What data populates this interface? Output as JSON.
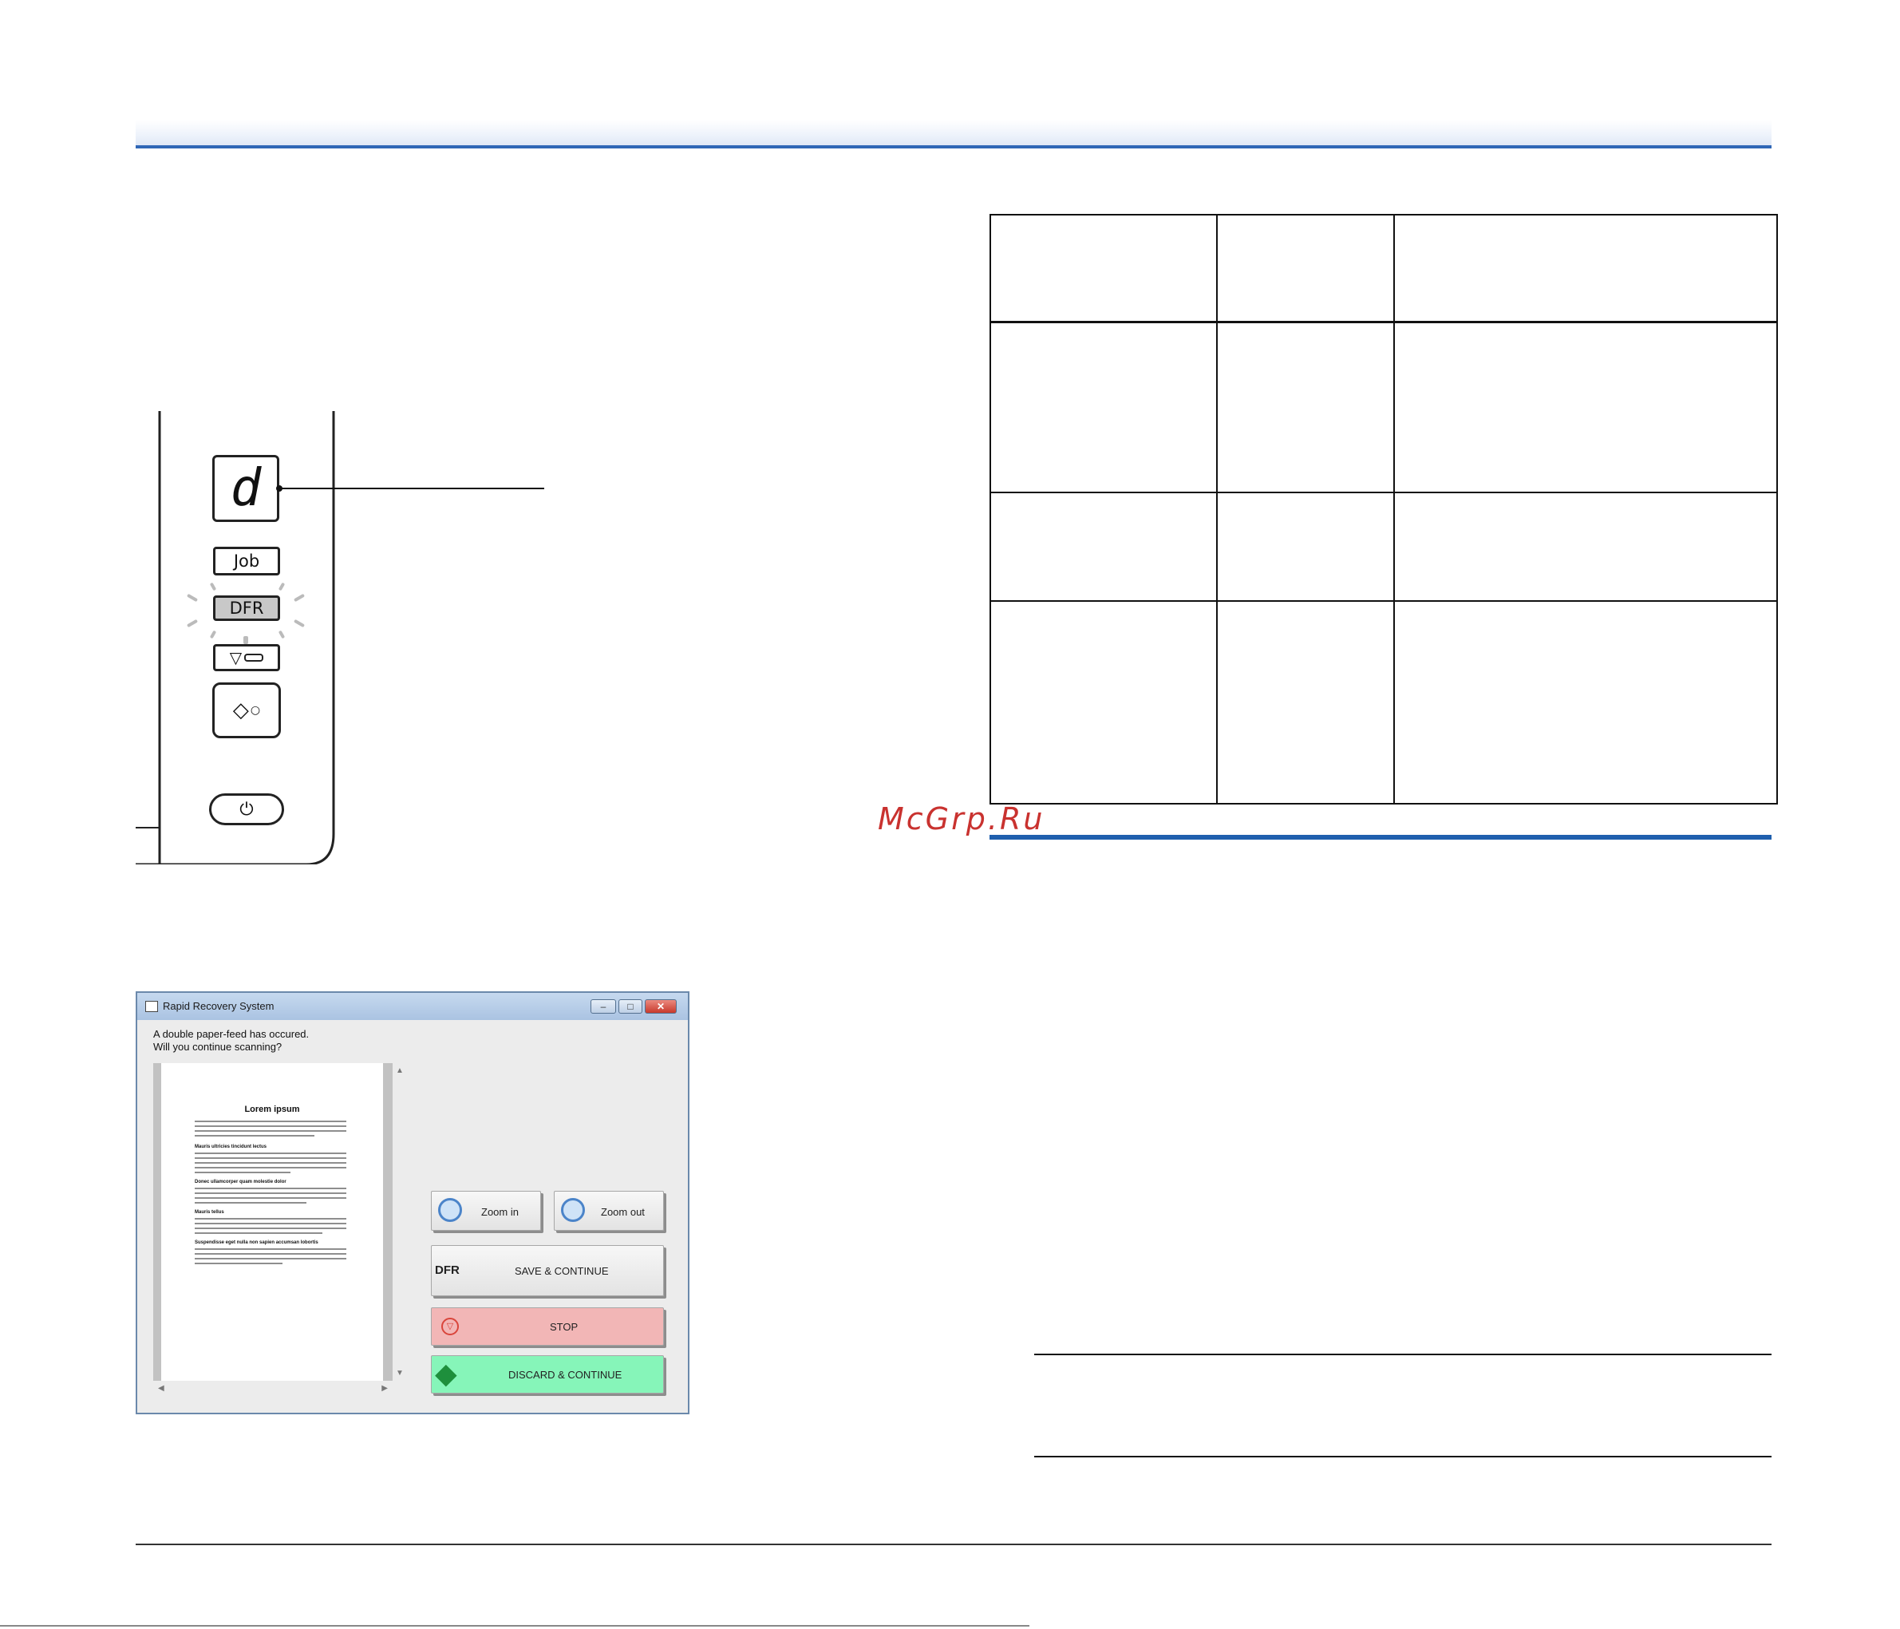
{
  "watermark": "McGrp.Ru",
  "panel": {
    "display_char": "d",
    "job_label": "Job",
    "dfr_label": "DFR"
  },
  "dialog": {
    "title": "Rapid Recovery System",
    "message_line1": "A double paper-feed has occured.",
    "message_line2": "Will you continue scanning?",
    "preview": {
      "heading": "Lorem ipsum",
      "sub1": "Mauris ultricies tincidunt lectus",
      "sub2": "Donec ullamcorper quam molestie dolor",
      "sub3": "Mauris tellus",
      "sub4": "Suspendisse eget nulla non sapien accumsan lobortis"
    },
    "buttons": {
      "zoom_in": "Zoom in",
      "zoom_out": "Zoom out",
      "dfr_tag": "DFR",
      "save_continue": "SAVE & CONTINUE",
      "stop": "STOP",
      "discard_continue": "DISCARD & CONTINUE"
    },
    "colors": {
      "stop_bg": "#f2b6b6",
      "discard_bg": "#86f5b9",
      "titlebar": "#b7cde8",
      "close_btn": "#d9453b"
    }
  }
}
